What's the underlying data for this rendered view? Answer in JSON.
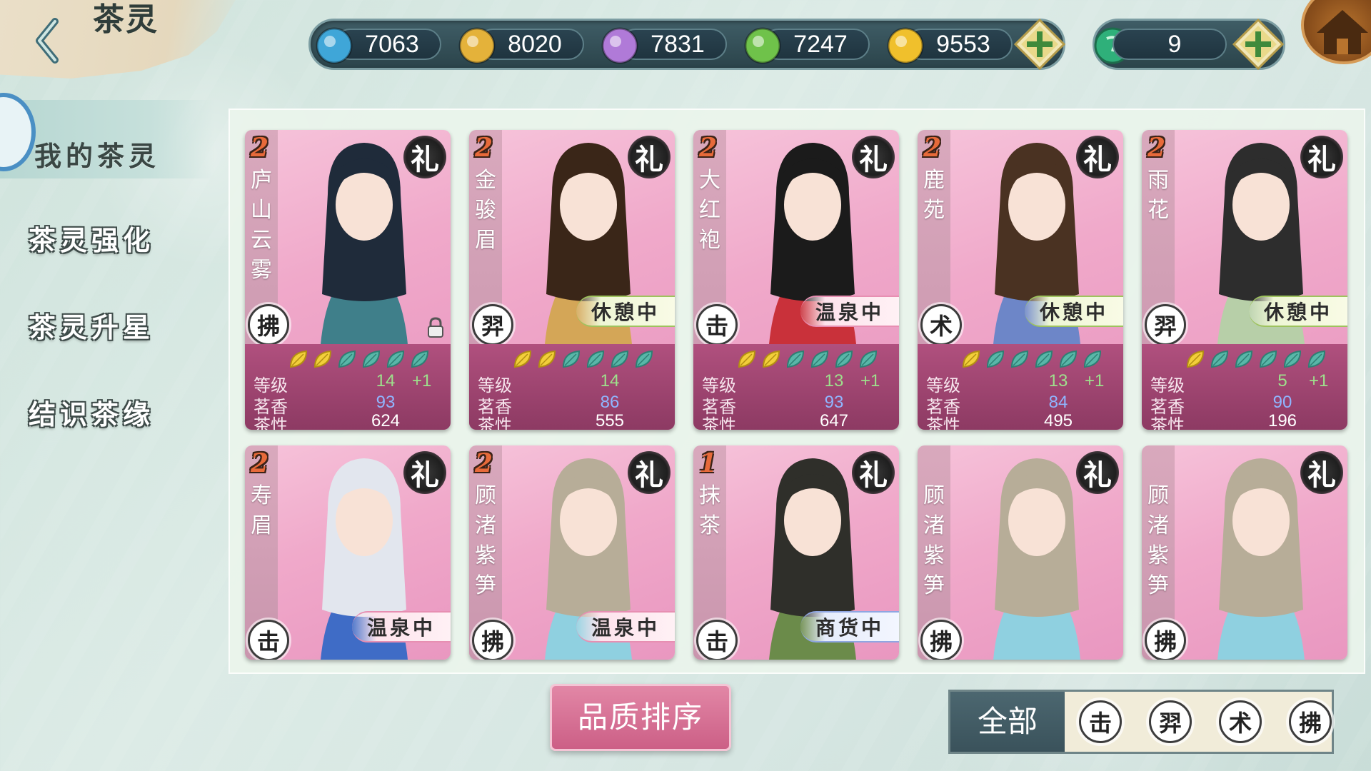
{
  "header": {
    "title": "茶灵",
    "resources": [
      {
        "name": "blue-gem",
        "value": "7063",
        "color": "#3fa6d8"
      },
      {
        "name": "gold-gem",
        "value": "8020",
        "color": "#e4b23a"
      },
      {
        "name": "purple-gem",
        "value": "7831",
        "color": "#b07ad8"
      },
      {
        "name": "green-gem",
        "value": "7247",
        "color": "#6fc24a"
      },
      {
        "name": "gold-coin",
        "value": "9553",
        "color": "#f0c02c"
      }
    ],
    "tea_seed": {
      "name": "tea-seed",
      "value": "9",
      "color": "#2fb07a"
    }
  },
  "menu": {
    "items": [
      {
        "label": "我的茶灵",
        "active": true
      },
      {
        "label": "茶灵强化",
        "active": false
      },
      {
        "label": "茶灵升星",
        "active": false
      },
      {
        "label": "结识茶缘",
        "active": false
      }
    ]
  },
  "cards": [
    {
      "rank": "2",
      "name": "庐山云雾",
      "tag": "礼",
      "class": "拂",
      "status": "",
      "status_type": "",
      "locked": true,
      "leaves_gold": 2,
      "leaves_total": 6,
      "level_label": "等级",
      "level": "14",
      "level_bonus": "+1",
      "aroma_label": "茗香",
      "aroma": "93",
      "nature_label": "茶性",
      "nature": "624"
    },
    {
      "rank": "2",
      "name": "金骏眉",
      "tag": "礼",
      "class": "羿",
      "status": "休憩中",
      "status_type": "rest",
      "locked": false,
      "leaves_gold": 2,
      "leaves_total": 6,
      "level_label": "等级",
      "level": "14",
      "level_bonus": "",
      "aroma_label": "茗香",
      "aroma": "86",
      "nature_label": "茶性",
      "nature": "555"
    },
    {
      "rank": "2",
      "name": "大红袍",
      "tag": "礼",
      "class": "击",
      "status": "温泉中",
      "status_type": "hot",
      "locked": false,
      "leaves_gold": 2,
      "leaves_total": 6,
      "level_label": "等级",
      "level": "13",
      "level_bonus": "+1",
      "aroma_label": "茗香",
      "aroma": "93",
      "nature_label": "茶性",
      "nature": "647"
    },
    {
      "rank": "2",
      "name": "鹿苑",
      "tag": "礼",
      "class": "术",
      "status": "休憩中",
      "status_type": "rest",
      "locked": false,
      "leaves_gold": 1,
      "leaves_total": 6,
      "level_label": "等级",
      "level": "13",
      "level_bonus": "+1",
      "aroma_label": "茗香",
      "aroma": "84",
      "nature_label": "茶性",
      "nature": "495"
    },
    {
      "rank": "2",
      "name": "雨花",
      "tag": "礼",
      "class": "羿",
      "status": "休憩中",
      "status_type": "rest",
      "locked": false,
      "leaves_gold": 1,
      "leaves_total": 6,
      "level_label": "等级",
      "level": "5",
      "level_bonus": "+1",
      "aroma_label": "茗香",
      "aroma": "90",
      "nature_label": "茶性",
      "nature": "196"
    },
    {
      "rank": "2",
      "name": "寿眉",
      "tag": "礼",
      "class": "击",
      "status": "温泉中",
      "status_type": "hot"
    },
    {
      "rank": "2",
      "name": "顾渚紫笋",
      "tag": "礼",
      "class": "拂",
      "status": "温泉中",
      "status_type": "hot"
    },
    {
      "rank": "1",
      "name": "抹茶",
      "tag": "礼",
      "class": "击",
      "status": "商货中",
      "status_type": "shop"
    },
    {
      "rank": "",
      "name": "顾渚紫笋",
      "tag": "礼",
      "class": "拂",
      "status": "",
      "status_type": ""
    },
    {
      "rank": "",
      "name": "顾渚紫笋",
      "tag": "礼",
      "class": "拂",
      "status": "",
      "status_type": ""
    }
  ],
  "bottom": {
    "sort_label": "品质排序",
    "filter_all": "全部",
    "filters": [
      "击",
      "羿",
      "术",
      "拂"
    ]
  },
  "colors": {
    "accent_pink": "#cc5f86",
    "card_stats_bg": "#8d3a63",
    "level_green": "#9ee08c",
    "aroma_blue": "#8fb6ff"
  }
}
